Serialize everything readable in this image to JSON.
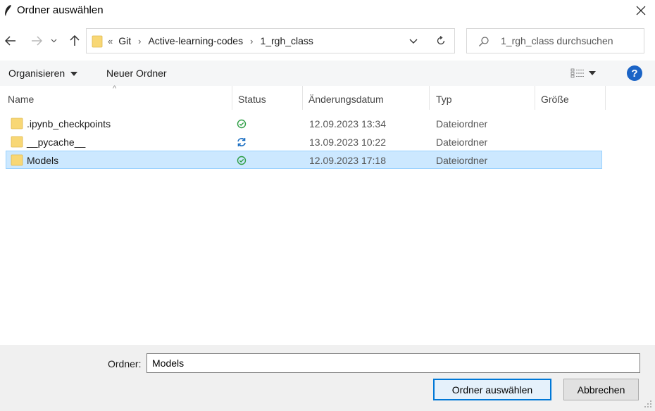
{
  "window": {
    "title": "Ordner auswählen"
  },
  "address": {
    "overflow_marker": "«",
    "crumbs": [
      "Git",
      "Active-learning-codes",
      "1_rgh_class"
    ]
  },
  "search": {
    "placeholder": "1_rgh_class durchsuchen"
  },
  "toolbar": {
    "organize_label": "Organisieren",
    "new_folder_label": "Neuer Ordner",
    "help_label": "?"
  },
  "columns": {
    "name": "Name",
    "status": "Status",
    "date": "Änderungsdatum",
    "type": "Typ",
    "size": "Größe"
  },
  "files": [
    {
      "name": ".ipynb_checkpoints",
      "status": "synced",
      "date": "12.09.2023 13:34",
      "type": "Dateiordner",
      "selected": false
    },
    {
      "name": "__pycache__",
      "status": "syncing",
      "date": "13.09.2023 10:22",
      "type": "Dateiordner",
      "selected": false
    },
    {
      "name": "Models",
      "status": "synced",
      "date": "12.09.2023 17:18",
      "type": "Dateiordner",
      "selected": true
    }
  ],
  "footer": {
    "folder_label": "Ordner:",
    "folder_value": "Models",
    "select_button": "Ordner auswählen",
    "cancel_button": "Abbrechen"
  },
  "colors": {
    "selection_bg": "#cce8ff",
    "selection_border": "#99d1ff",
    "accent": "#0078d7",
    "status_synced": "#2e9e45",
    "status_syncing": "#1b6ec2",
    "folder_yellow": "#f8d775"
  }
}
